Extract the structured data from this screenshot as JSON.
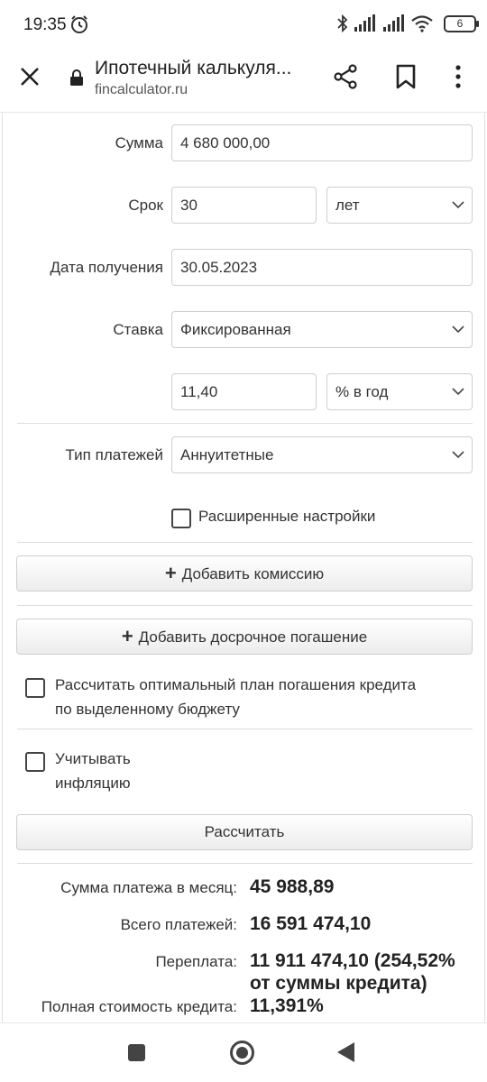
{
  "status": {
    "time": "19:35",
    "battery": "6"
  },
  "browser": {
    "title": "Ипотечный калькуля...",
    "url": "fincalculator.ru"
  },
  "form": {
    "sum": {
      "label": "Сумма",
      "value": "4 680 000,00"
    },
    "term": {
      "label": "Срок",
      "value": "30",
      "unit": "лет"
    },
    "date": {
      "label": "Дата получения",
      "value": "30.05.2023"
    },
    "rate": {
      "label": "Ставка",
      "type": "Фиксированная",
      "value": "11,40",
      "unit": "% в год"
    },
    "payment_type": {
      "label": "Тип платежей",
      "value": "Аннуитетные"
    },
    "advanced": {
      "label": "Расширенные настройки",
      "checked": false
    },
    "add_commission": "Добавить комиссию",
    "add_prepayment": "Добавить досрочное погашение",
    "optimal_plan": {
      "line1": "Рассчитать оптимальный план погашения кредита",
      "line2": "по выделенному бюджету",
      "checked": false
    },
    "inflation": {
      "line1": "Учитывать",
      "line2": "инфляцию",
      "checked": false
    },
    "calculate": "Рассчитать"
  },
  "results": {
    "monthly": {
      "label": "Сумма платежа в месяц:",
      "value": "45 988,89"
    },
    "total": {
      "label": "Всего платежей:",
      "value": "16 591 474,10"
    },
    "overpay": {
      "label": "Переплата:",
      "value1": "11 911 474,10 (254,52%",
      "value2": "от суммы кредита)"
    },
    "full_cost": {
      "label": "Полная стоимость кредита:",
      "value": "11,391%"
    }
  }
}
